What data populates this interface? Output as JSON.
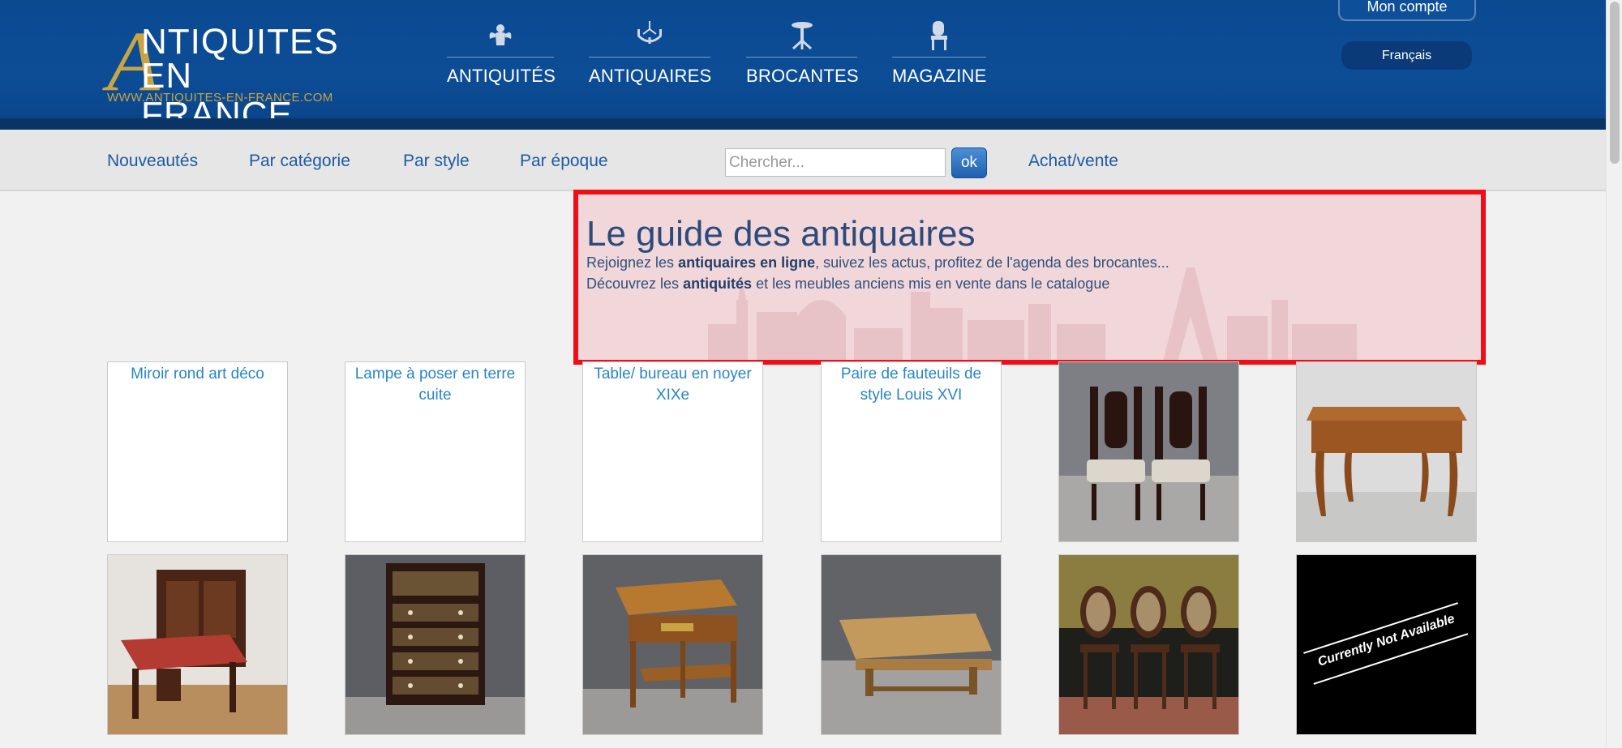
{
  "header": {
    "logo": {
      "big_letter": "A",
      "line1": "NTIQUITES",
      "line2": "EN FRANCE",
      "url": "WWW.ANTIQUITES-EN-FRANCE.COM"
    },
    "nav": [
      {
        "label": "ANTIQUITÉS",
        "icon": "cherub-icon"
      },
      {
        "label": "ANTIQUAIRES",
        "icon": "chandelier-icon"
      },
      {
        "label": "BROCANTES",
        "icon": "pedestal-table-icon"
      },
      {
        "label": "MAGAZINE",
        "icon": "chair-icon"
      }
    ],
    "account_label": "Mon compte",
    "language_label": "Français"
  },
  "subnav": {
    "links": [
      "Nouveautés",
      "Par catégorie",
      "Par style",
      "Par époque"
    ],
    "search_placeholder": "Chercher...",
    "search_button": "ok",
    "achat_vente": "Achat/vente"
  },
  "guide": {
    "title": "Le guide des antiquaires",
    "p1_before": "Rejoignez les ",
    "p1_bold": "antiquaires en ligne",
    "p1_after": ", suivez les actus, profitez de l'agenda des brocantes...",
    "p2_before": "Découvrez les ",
    "p2_bold": "antiquités",
    "p2_after": " et les meubles anciens mis en vente dans le catalogue"
  },
  "products": [
    {
      "alt": "Miroir rond art déco",
      "kind": "broken"
    },
    {
      "alt": "Lampe à poser en terre cuite",
      "kind": "broken"
    },
    {
      "alt": "Table/ bureau en noyer XIXe",
      "kind": "broken"
    },
    {
      "alt": "Paire de fauteuils de style Louis XVI",
      "kind": "broken"
    },
    {
      "alt": "",
      "kind": "chairs-pair"
    },
    {
      "alt": "",
      "kind": "table-walnut"
    },
    {
      "alt": "",
      "kind": "desk-red"
    },
    {
      "alt": "",
      "kind": "cabinet-lacquer"
    },
    {
      "alt": "",
      "kind": "side-table"
    },
    {
      "alt": "",
      "kind": "coffee-table"
    },
    {
      "alt": "",
      "kind": "chairs-cane"
    },
    {
      "alt": "",
      "kind": "not-available",
      "caption": "Currently Not Available"
    }
  ],
  "colors": {
    "header_blue": "#0c4d96",
    "logo_gold": "#c9a445",
    "link_blue": "#1d5aa1",
    "highlight_red": "#ef0d18"
  }
}
